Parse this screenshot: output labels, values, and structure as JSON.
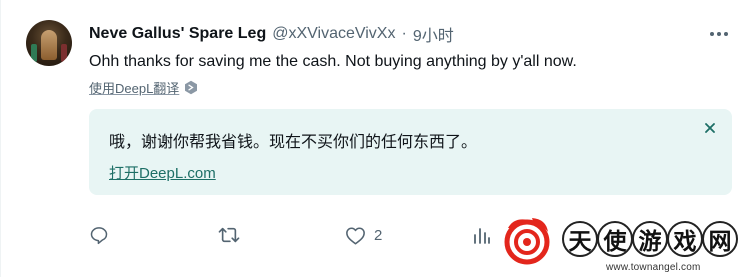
{
  "tweet": {
    "display_name": "Neve Gallus' Spare Leg",
    "handle": "@xXVivaceVivXx",
    "separator": "·",
    "time": "9小时",
    "text": "Ohh thanks for saving me the cash. Not buying anything by y'all now.",
    "translate_label": "使用DeepL翻译"
  },
  "translation": {
    "text": "哦，谢谢你帮我省钱。现在不买你们的任何东西了。",
    "open_link": "打开DeepL.com"
  },
  "actions": {
    "reply_count": "",
    "retweet_count": "",
    "like_count": "2",
    "views_count": ""
  },
  "watermark": {
    "chars": [
      "天",
      "使",
      "游",
      "戏",
      "网"
    ],
    "url": "www.townangel.com"
  },
  "colors": {
    "text": "#0f1419",
    "muted": "#536471",
    "translation_bg": "#e8f5f4",
    "translation_link": "#1d6f66",
    "watermark_red": "#e3261c"
  }
}
